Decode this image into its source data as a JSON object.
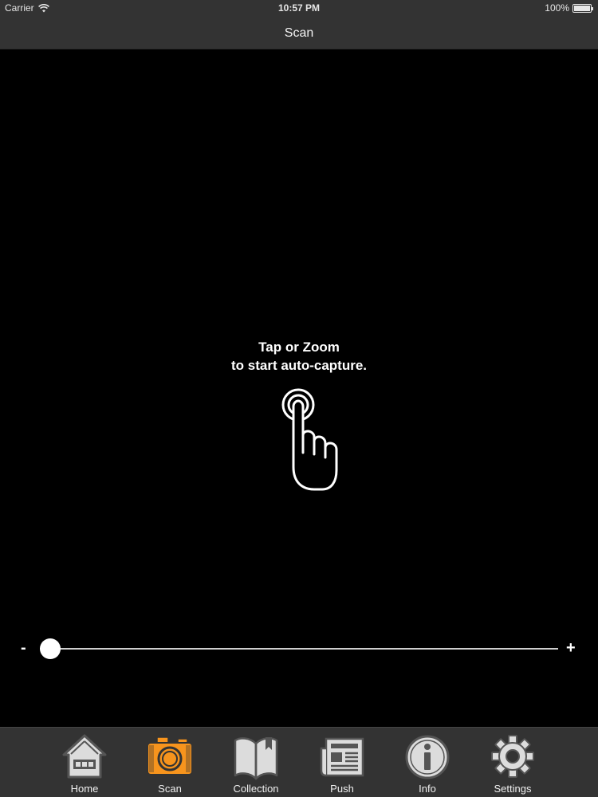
{
  "status_bar": {
    "carrier": "Carrier",
    "time": "10:57 PM",
    "battery": "100%",
    "battery_level": 1.0
  },
  "nav": {
    "title": "Scan"
  },
  "viewfinder": {
    "hint_line1": "Tap or Zoom",
    "hint_line2": "to start auto-capture."
  },
  "zoom": {
    "minus_label": "-",
    "plus_label": "+",
    "level": 0.02
  },
  "tabs": [
    {
      "id": "home",
      "label": "Home",
      "icon": "home-icon",
      "active": false
    },
    {
      "id": "scan",
      "label": "Scan",
      "icon": "camera-icon",
      "active": true
    },
    {
      "id": "collection",
      "label": "Collection",
      "icon": "book-icon",
      "active": false
    },
    {
      "id": "push",
      "label": "Push",
      "icon": "newspaper-icon",
      "active": false
    },
    {
      "id": "info",
      "label": "Info",
      "icon": "info-icon",
      "active": false
    },
    {
      "id": "settings",
      "label": "Settings",
      "icon": "gear-icon",
      "active": false
    }
  ],
  "colors": {
    "bar_background": "#333333",
    "active_tab": "#f7941d",
    "inactive_tab_fill": "#dcdcdc",
    "inactive_tab_stroke": "#555555"
  }
}
